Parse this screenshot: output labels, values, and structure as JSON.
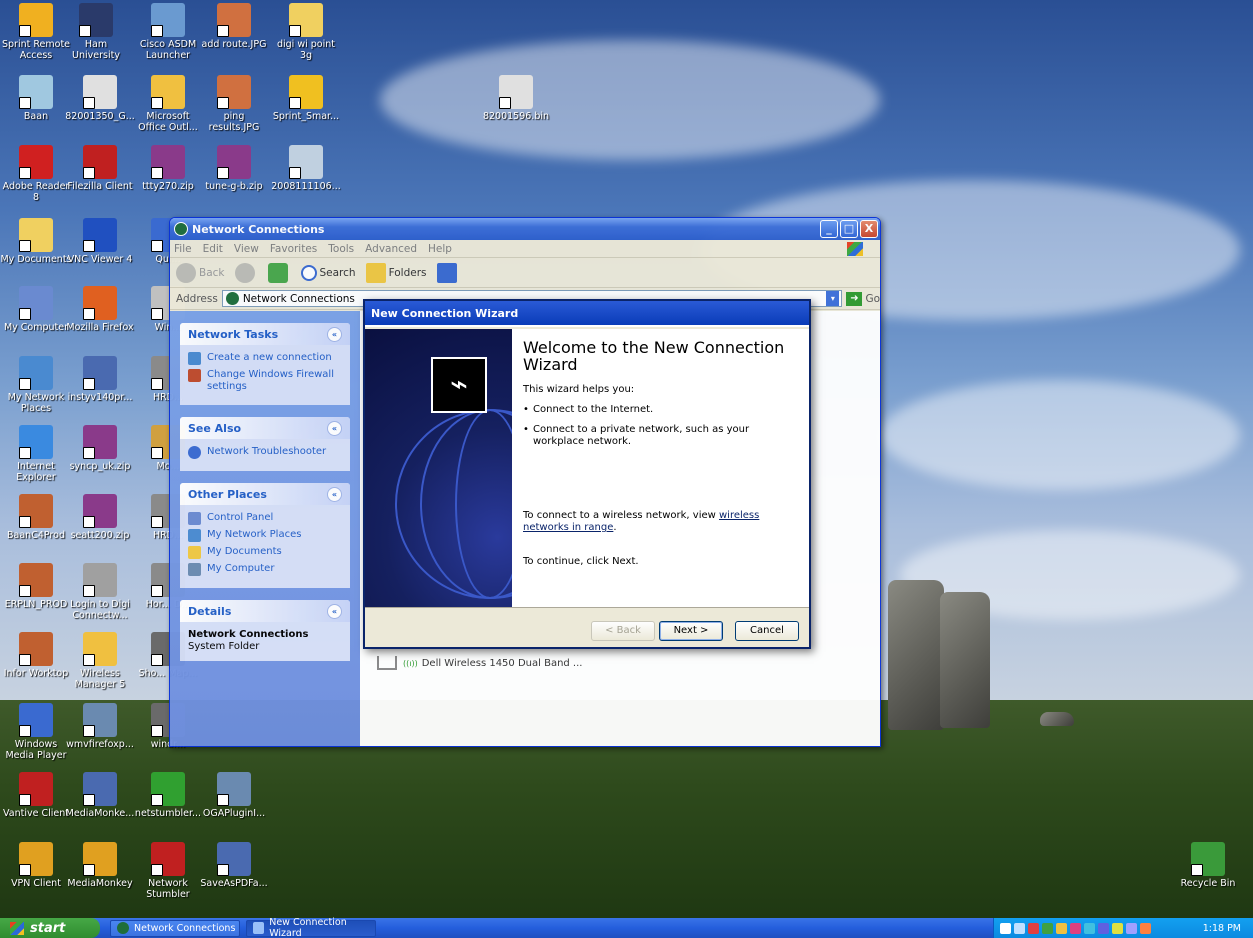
{
  "desktop": {
    "icons": [
      {
        "label": "Sprint Remote Access",
        "color": "#f0b020"
      },
      {
        "label": "Ham University",
        "color": "#2a3a6a"
      },
      {
        "label": "Cisco ASDM Launcher",
        "color": "#6a9ad0"
      },
      {
        "label": "add route.JPG",
        "color": "#d07040"
      },
      {
        "label": "digi wi point 3g",
        "color": "#f0d060"
      },
      {
        "label": "Baan",
        "color": "#a0c8e0"
      },
      {
        "label": "82001350_G...",
        "color": "#e0e0e0"
      },
      {
        "label": "Microsoft Office Outl...",
        "color": "#f0c040"
      },
      {
        "label": "ping results.JPG",
        "color": "#d07040"
      },
      {
        "label": "Sprint_Smar...",
        "color": "#f0c020"
      },
      {
        "label": "82001596.bin",
        "color": "#e0e0e0"
      },
      {
        "label": "Adobe Reader 8",
        "color": "#d02020"
      },
      {
        "label": "Filezilla Client",
        "color": "#c02020"
      },
      {
        "label": "ttty270.zip",
        "color": "#8a3a8a"
      },
      {
        "label": "tune-g-b.zip",
        "color": "#8a3a8a"
      },
      {
        "label": "2008111106...",
        "color": "#c0d0e0"
      },
      {
        "label": "My Documents",
        "color": "#f0d060"
      },
      {
        "label": "VNC Viewer 4",
        "color": "#2050c0"
      },
      {
        "label": "Qui...",
        "color": "#3a6ad0"
      },
      {
        "label": "My Computer",
        "color": "#6a8ad0"
      },
      {
        "label": "Mozilla Firefox",
        "color": "#e06020"
      },
      {
        "label": "Win...",
        "color": "#c0c0c0"
      },
      {
        "label": "My Network Places",
        "color": "#4a8ad0"
      },
      {
        "label": "instyv140pr...",
        "color": "#4a6ab0"
      },
      {
        "label": "HRD...",
        "color": "#8a8a8a"
      },
      {
        "label": "Internet Explorer",
        "color": "#3a8ae0"
      },
      {
        "label": "syncp_uk.zip",
        "color": "#8a3a8a"
      },
      {
        "label": "Mo...",
        "color": "#d0a040"
      },
      {
        "label": "BaanC4Prod",
        "color": "#c06030"
      },
      {
        "label": "seatt200.zip",
        "color": "#8a3a8a"
      },
      {
        "label": "HRD...",
        "color": "#8a8a8a"
      },
      {
        "label": "ERPLN_PROD",
        "color": "#c06030"
      },
      {
        "label": "Login to Digi Connectw...",
        "color": "#a0a0a0"
      },
      {
        "label": "Hor... D...",
        "color": "#8a8a8a"
      },
      {
        "label": "Infor Worktop",
        "color": "#c06030"
      },
      {
        "label": "Wireless Manager 5",
        "color": "#f0c040"
      },
      {
        "label": "Sho... Map...",
        "color": "#6a6a6a"
      },
      {
        "label": "Windows Media Player",
        "color": "#3a6ad0"
      },
      {
        "label": "wmvfirefoxp...",
        "color": "#6a8ab0"
      },
      {
        "label": "windr...",
        "color": "#6a6a6a"
      },
      {
        "label": "Vantive Client",
        "color": "#c02020"
      },
      {
        "label": "MediaMonke...",
        "color": "#4a6ab0"
      },
      {
        "label": "netstumbler...",
        "color": "#30a030"
      },
      {
        "label": "OGAPluginI...",
        "color": "#6a8ab0"
      },
      {
        "label": "VPN Client",
        "color": "#e0a020"
      },
      {
        "label": "MediaMonkey",
        "color": "#e0a020"
      },
      {
        "label": "Network Stumbler",
        "color": "#c02020"
      },
      {
        "label": "SaveAsPDFa...",
        "color": "#4a6ab0"
      },
      {
        "label": "Recycle Bin",
        "color": "#3a9a3a"
      }
    ]
  },
  "window": {
    "title": "Network Connections",
    "menu": [
      "File",
      "Edit",
      "View",
      "Favorites",
      "Tools",
      "Advanced",
      "Help"
    ],
    "toolbar": {
      "back": "Back",
      "search": "Search",
      "folders": "Folders"
    },
    "address_label": "Address",
    "address_value": "Network Connections",
    "go_label": "Go",
    "minimize": "_",
    "maximize": "□",
    "close": "X",
    "dropdown": "▾",
    "chevron": "«",
    "tasks": {
      "network": {
        "title": "Network Tasks",
        "items": [
          "Create a new connection",
          "Change Windows Firewall settings"
        ]
      },
      "see_also": {
        "title": "See Also",
        "items": [
          "Network Troubleshooter"
        ]
      },
      "other": {
        "title": "Other Places",
        "items": [
          "Control Panel",
          "My Network Places",
          "My Documents",
          "My Computer"
        ]
      },
      "details": {
        "title": "Details",
        "name": "Network Connections",
        "type": "System Folder"
      }
    },
    "connection": "Dell Wireless 1450 Dual Band ...",
    "connection_signal": "((ı))"
  },
  "wizard": {
    "title": "New Connection Wizard",
    "heading": "Welcome to the New Connection Wizard",
    "intro": "This wizard helps you:",
    "bullets": [
      "Connect to the Internet.",
      "Connect to a private network, such as your workplace network."
    ],
    "bullet_mark": "•",
    "wireless_prefix": "To connect to a wireless network, view",
    "wireless_link": "wireless networks in range",
    "wireless_suffix": ".",
    "continue": "To continue, click Next.",
    "back_btn": "< Back",
    "next_btn": "Next >",
    "cancel_btn": "Cancel"
  },
  "taskbar": {
    "start": "start",
    "buttons": [
      "Network Connections",
      "New Connection Wizard"
    ],
    "clock": "1:18 PM"
  }
}
